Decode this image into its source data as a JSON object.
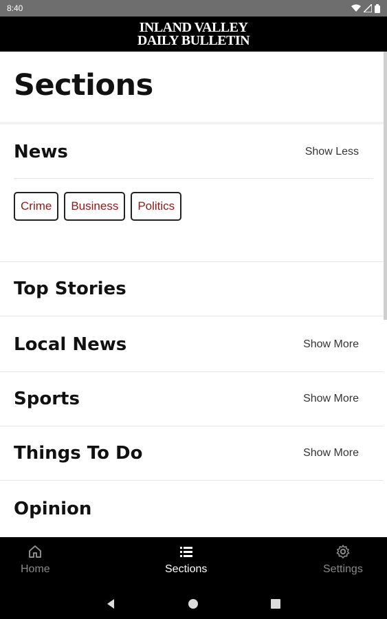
{
  "status_bar": {
    "time": "8:40"
  },
  "header": {
    "line1": "INLAND VALLEY",
    "line2": "DAILY BULLETIN"
  },
  "page": {
    "title": "Sections"
  },
  "news": {
    "name": "News",
    "toggle": "Show Less",
    "chips": [
      "Crime",
      "Business",
      "Politics"
    ]
  },
  "sections": [
    {
      "name": "Top Stories",
      "toggle": ""
    },
    {
      "name": "Local News",
      "toggle": "Show More"
    },
    {
      "name": "Sports",
      "toggle": "Show More"
    },
    {
      "name": "Things To Do",
      "toggle": "Show More"
    },
    {
      "name": "Opinion",
      "toggle": ""
    }
  ],
  "bottom_nav": [
    {
      "label": "Home",
      "icon": "home-icon",
      "active": false
    },
    {
      "label": "Sections",
      "icon": "list-icon",
      "active": true
    },
    {
      "label": "Settings",
      "icon": "gear-icon",
      "active": false
    }
  ],
  "colors": {
    "chip_text": "#8b1a1a",
    "header_bg": "#000000",
    "nav_active": "#ffffff",
    "nav_inactive": "#8a8a8a"
  }
}
